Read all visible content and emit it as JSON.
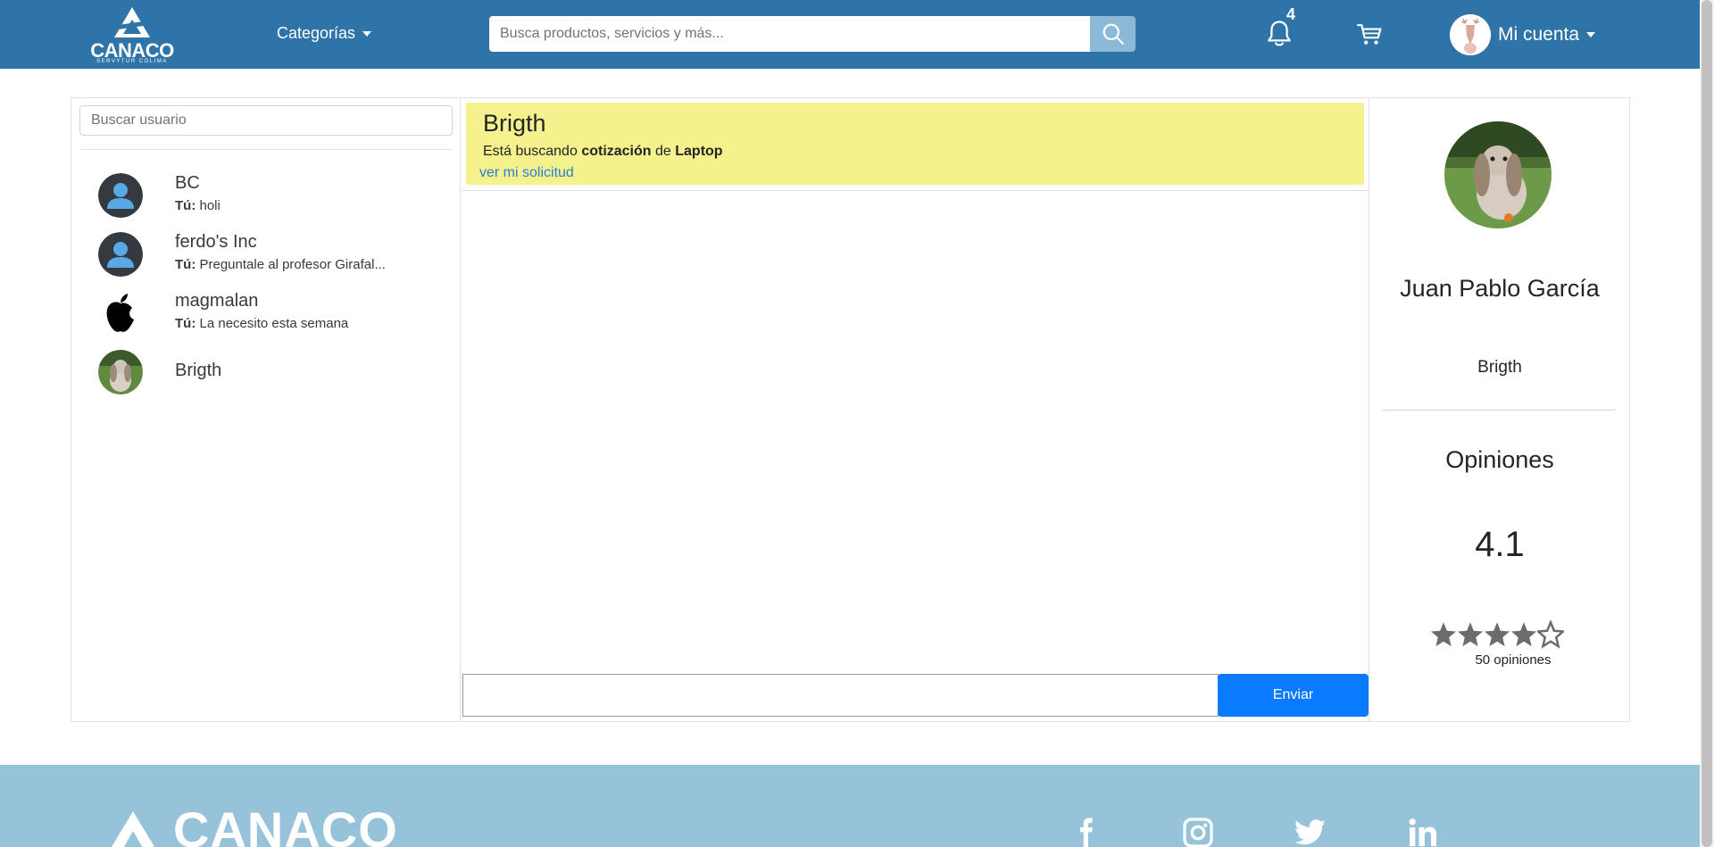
{
  "navbar": {
    "logo_text": "CANACO",
    "logo_sub": "SERVYTUR COLIMA",
    "categories_label": "Categorías",
    "search_placeholder": "Busca productos, servicios y más...",
    "notification_count": "4",
    "account_label": "Mi cuenta"
  },
  "sidebar": {
    "search_placeholder": "Buscar usuario",
    "contacts": [
      {
        "name": "BC",
        "prefix": "Tú:",
        "last_message": "holi",
        "avatar": "user-silhouette-icon"
      },
      {
        "name": "ferdo's Inc",
        "prefix": "Tú:",
        "last_message": "Preguntale al profesor Girafal...",
        "avatar": "user-silhouette-icon"
      },
      {
        "name": "magmalan",
        "prefix": "Tú:",
        "last_message": "La necesito esta semana",
        "avatar": "apple-logo-icon"
      },
      {
        "name": "Brigth",
        "prefix": "",
        "last_message": "",
        "avatar": "rabbit-photo"
      }
    ]
  },
  "chat": {
    "banner": {
      "title": "Brigth",
      "text_pre": "Está buscando",
      "text_bold1": "cotización",
      "text_mid": "de",
      "text_bold2": "Laptop",
      "link": "ver mi solicitud"
    },
    "message_placeholder": "",
    "send_label": "Enviar"
  },
  "profile": {
    "name": "Juan Pablo García",
    "username": "Brigth",
    "opinions_title": "Opiniones",
    "rating": "4.1",
    "rating_value": 4.1,
    "rating_max": 5,
    "review_count": "50 opiniones"
  },
  "footer": {
    "logo_text": "CANACO",
    "social": [
      "facebook-icon",
      "instagram-icon",
      "twitter-icon",
      "linkedin-icon"
    ]
  },
  "colors": {
    "navbar": "#2f74a8",
    "search_button": "#8cbad6",
    "banner": "#f5f18c",
    "send_button": "#0a7bff",
    "footer": "#96c3d9",
    "link": "#2b7fd5",
    "star": "#6c6c6c"
  }
}
